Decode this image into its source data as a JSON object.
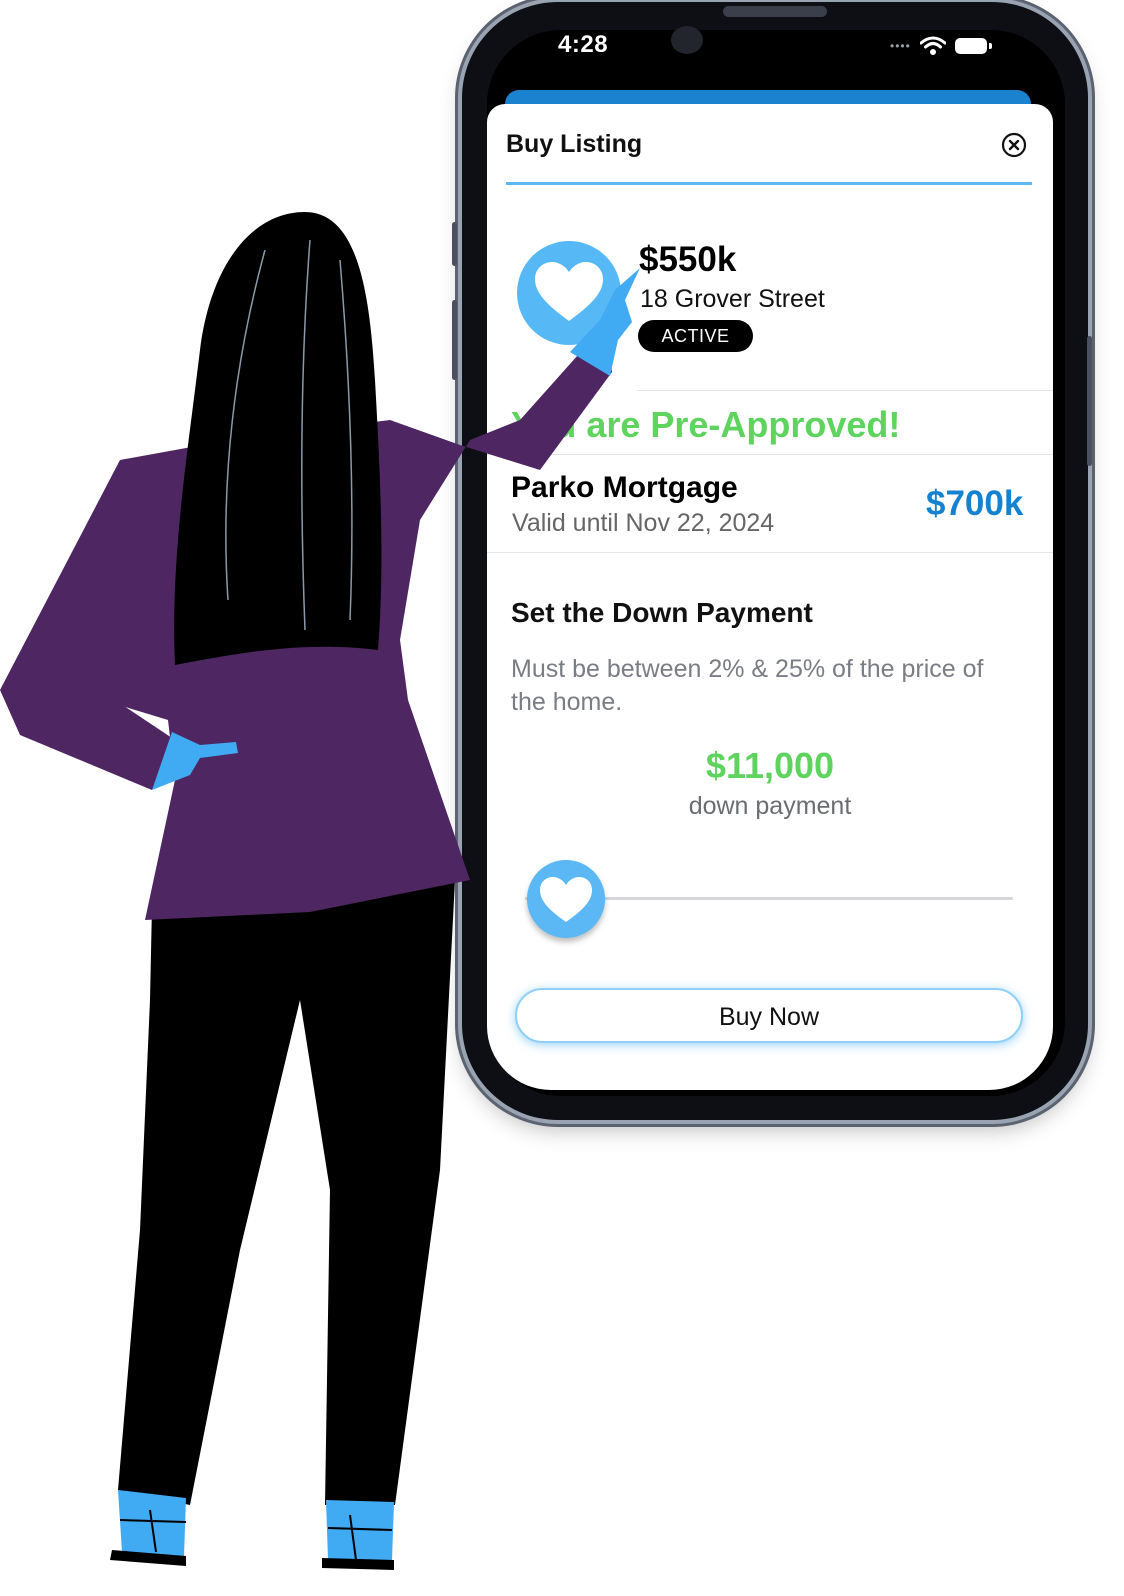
{
  "status_bar": {
    "time": "4:28"
  },
  "sheet": {
    "title": "Buy Listing",
    "close_icon": "close-circle-icon"
  },
  "listing": {
    "price": "$550k",
    "address": "18 Grover Street",
    "status": "ACTIVE",
    "icon": "heart-icon"
  },
  "preapproval": {
    "headline": "You are Pre-Approved!",
    "lender": "Parko Mortgage",
    "valid_until": "Valid until Nov 22, 2024",
    "amount": "$700k"
  },
  "down_payment": {
    "heading": "Set the Down Payment",
    "description": "Must be between 2% & 25% of the price of the home.",
    "value": "$11,000",
    "caption": "down payment",
    "slider_fraction": 0.02
  },
  "actions": {
    "buy_label": "Buy Now"
  },
  "colors": {
    "accent_blue": "#1582cf",
    "light_blue": "#56b8f5",
    "green": "#5ed35d",
    "suit_purple": "#4e2661"
  }
}
